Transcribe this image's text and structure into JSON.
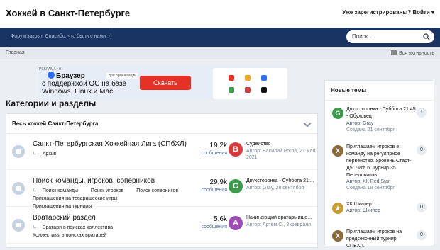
{
  "header": {
    "site_title": "Хоккей в Санкт-Петербурге",
    "signin": "Уже зарегистрированы? Войти ▾"
  },
  "navbar": {
    "message": "Форум закрыт. Спасибо, что были с нами :-)",
    "search_placeholder": "Поиск..."
  },
  "breadcrumb": {
    "home": "Главная",
    "activity": "Вся активность"
  },
  "ad": {
    "label": "РЕКЛАМА • 0+",
    "brand": "Браузер",
    "sub": "для организаций",
    "text": "с поддержкой ОС на базе Windows, Linux и Mac",
    "button": "Скачать"
  },
  "main": {
    "title": "Категории и разделы",
    "category": "Весь хоккей Санкт-Петербурга",
    "forums": [
      {
        "name": "Санкт-Петербургская Хоккейная Лига (СПбХЛ)",
        "subs": [
          "Архив"
        ],
        "count": "19,2k",
        "count_label": "сообщения",
        "avatar": "В",
        "avatar_color": "#d93b3b",
        "last_title": "Судейство",
        "last_meta": "Автор: Василий Рогов, 21 мая 2021"
      },
      {
        "name": "Поиск команды, игроков, соперников",
        "subs": [
          "Поиск команды",
          "Поиск игроков",
          "Поиск соперников",
          "Приглашения на товарищеские игры",
          "Приглашения на турниры"
        ],
        "count": "29,9k",
        "count_label": "сообщения",
        "avatar": "G",
        "avatar_color": "#3a9c4b",
        "last_title": "Двухсторонка - Суббота 21:...",
        "last_meta": "Автор: Gray, 28 сентября"
      },
      {
        "name": "Вратарский раздел",
        "subs": [
          "Вратари в поисках коллектива",
          "Коллективы в поисках вратарей"
        ],
        "count": "5,6k",
        "count_label": "сообщения",
        "avatar": "A",
        "avatar_color": "#9e4cb5",
        "last_title": "Начинающий вратарь ище...",
        "last_meta": "Автор: Артём С., 3 февраля"
      }
    ]
  },
  "sidebar": {
    "title": "Новые темы",
    "topics": [
      {
        "avatar": "G",
        "color": "#3a9c4b",
        "title": "Двухсторонка - Суббота 21:45 - Обуховец",
        "author": "Автор: Gray",
        "date": "Создана 21 сентября",
        "badge": "1"
      },
      {
        "avatar": "X",
        "color": "#8b6a3a",
        "title": "Приглашаем игроков в команду на регулярное первенство. Уровень Старт-Д5. Лига 6. Турнир 35 Передовиков",
        "author": "Автор: ХК Red Star",
        "date": "Создана 18 сентября",
        "badge": "0"
      },
      {
        "avatar": "★",
        "color": "#c99a2e",
        "title": "ХК Шкипер",
        "author": "Автор: Шкипер",
        "date": "",
        "badge": "0"
      },
      {
        "avatar": "X",
        "color": "#8b6a3a",
        "title": "Приглашаем игроков на предсезонный турнир СПБХЛ.",
        "author": "",
        "date": "",
        "badge": "0"
      }
    ]
  }
}
